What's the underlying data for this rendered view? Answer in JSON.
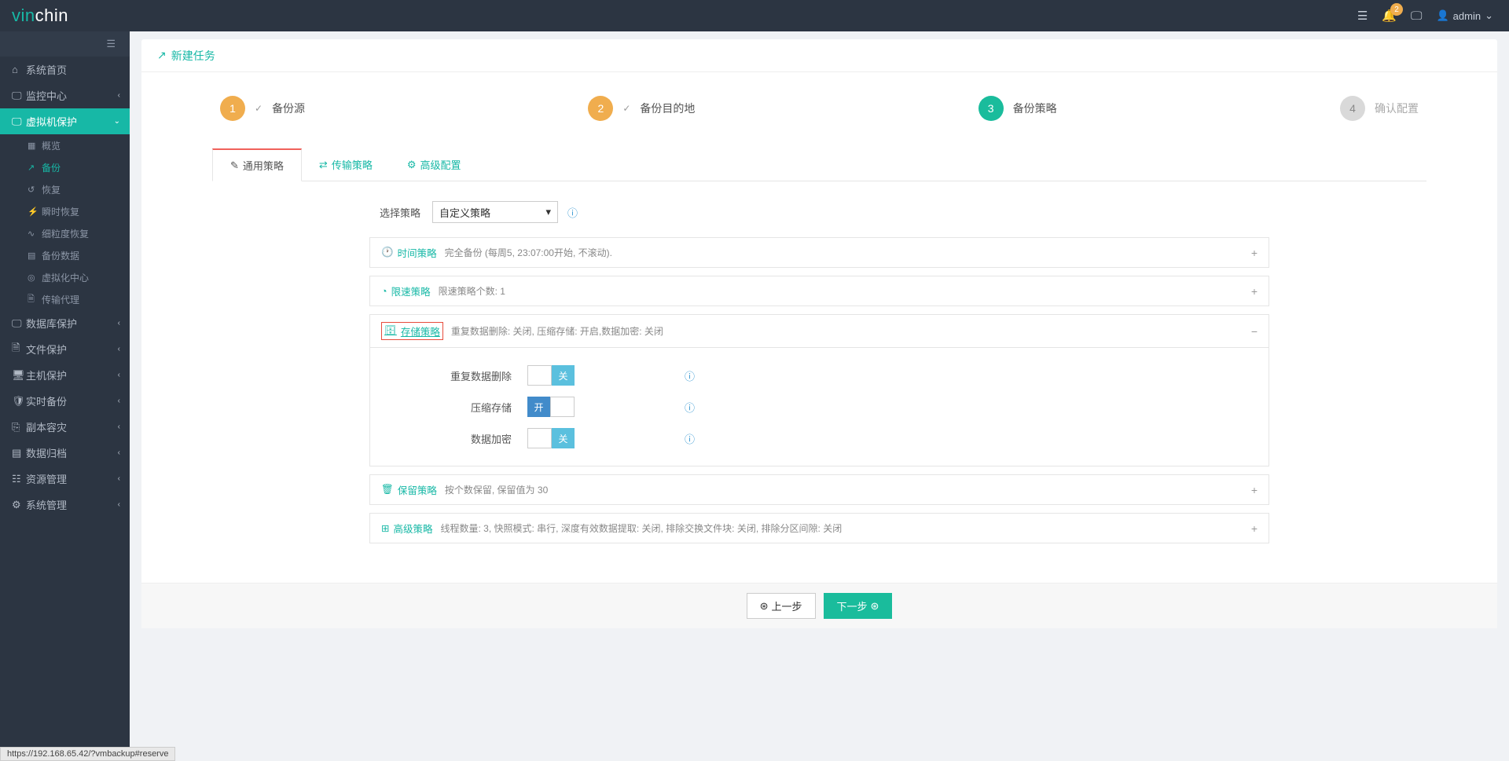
{
  "logo": {
    "p1": "vin",
    "p2": "chin"
  },
  "topbar": {
    "badge": "2",
    "user": "admin"
  },
  "sidebar": {
    "items": [
      {
        "icon": "⌂",
        "label": "系统首页"
      },
      {
        "icon": "🖵",
        "label": "监控中心",
        "arr": "‹"
      },
      {
        "icon": "🖵",
        "label": "虚拟机保护",
        "arr": "⌄",
        "active": true
      },
      {
        "icon": "🖵",
        "label": "数据库保护",
        "arr": "‹"
      },
      {
        "icon": "🗎",
        "label": "文件保护",
        "arr": "‹"
      },
      {
        "icon": "🖥",
        "label": "主机保护",
        "arr": "‹"
      },
      {
        "icon": "🛡",
        "label": "实时备份",
        "arr": "‹"
      },
      {
        "icon": "⎘",
        "label": "副本容灾",
        "arr": "‹"
      },
      {
        "icon": "▤",
        "label": "数据归档",
        "arr": "‹"
      },
      {
        "icon": "☷",
        "label": "资源管理",
        "arr": "‹"
      },
      {
        "icon": "⚙",
        "label": "系统管理",
        "arr": "‹"
      }
    ],
    "subs": [
      {
        "icon": "▦",
        "label": "概览"
      },
      {
        "icon": "↗",
        "label": "备份",
        "active": true
      },
      {
        "icon": "↺",
        "label": "恢复"
      },
      {
        "icon": "⚡",
        "label": "瞬时恢复"
      },
      {
        "icon": "∿",
        "label": "细粒度恢复"
      },
      {
        "icon": "▤",
        "label": "备份数据"
      },
      {
        "icon": "◎",
        "label": "虚拟化中心"
      },
      {
        "icon": "🗎",
        "label": "传输代理"
      }
    ]
  },
  "panel": {
    "title": "新建任务"
  },
  "wizard": [
    {
      "num": "1",
      "label": "备份源",
      "state": "done",
      "check": true
    },
    {
      "num": "2",
      "label": "备份目的地",
      "state": "done",
      "check": true
    },
    {
      "num": "3",
      "label": "备份策略",
      "state": "cur"
    },
    {
      "num": "4",
      "label": "确认配置",
      "state": "pend"
    }
  ],
  "tabs": [
    {
      "icon": "✎",
      "label": "通用策略",
      "active": true
    },
    {
      "icon": "⇄",
      "label": "传输策略"
    },
    {
      "icon": "⚙",
      "label": "高级配置"
    }
  ],
  "form": {
    "select_label": "选择策略",
    "select_value": "自定义策略"
  },
  "accordions": [
    {
      "icon": "🕐",
      "title": "时间策略",
      "desc": "完全备份 (每周5, 23:07:00开始, 不滚动).",
      "toggle": "+"
    },
    {
      "icon": "◔",
      "title": "限速策略",
      "desc": "限速策略个数: 1",
      "toggle": "+"
    },
    {
      "icon": "🗄",
      "title": "存储策略",
      "desc": "重复数据删除: 关闭, 压缩存储: 开启,数据加密: 关闭",
      "toggle": "−",
      "hl": true,
      "open": true
    },
    {
      "icon": "🗑",
      "title": "保留策略",
      "desc": "按个数保留, 保留值为 30",
      "toggle": "+"
    },
    {
      "icon": "⊞",
      "title": "高级策略",
      "desc": "线程数量: 3, 快照模式: 串行, 深度有效数据提取: 关闭, 排除交换文件块: 关闭, 排除分区间隙: 关闭",
      "toggle": "+"
    }
  ],
  "storage_opts": [
    {
      "label": "重复数据删除",
      "on": false,
      "txt": "关"
    },
    {
      "label": "压缩存储",
      "on": true,
      "txt": "开"
    },
    {
      "label": "数据加密",
      "on": false,
      "txt": "关"
    }
  ],
  "buttons": {
    "prev": "上一步",
    "next": "下一步"
  },
  "status": "https://192.168.65.42/?vmbackup#reserve"
}
